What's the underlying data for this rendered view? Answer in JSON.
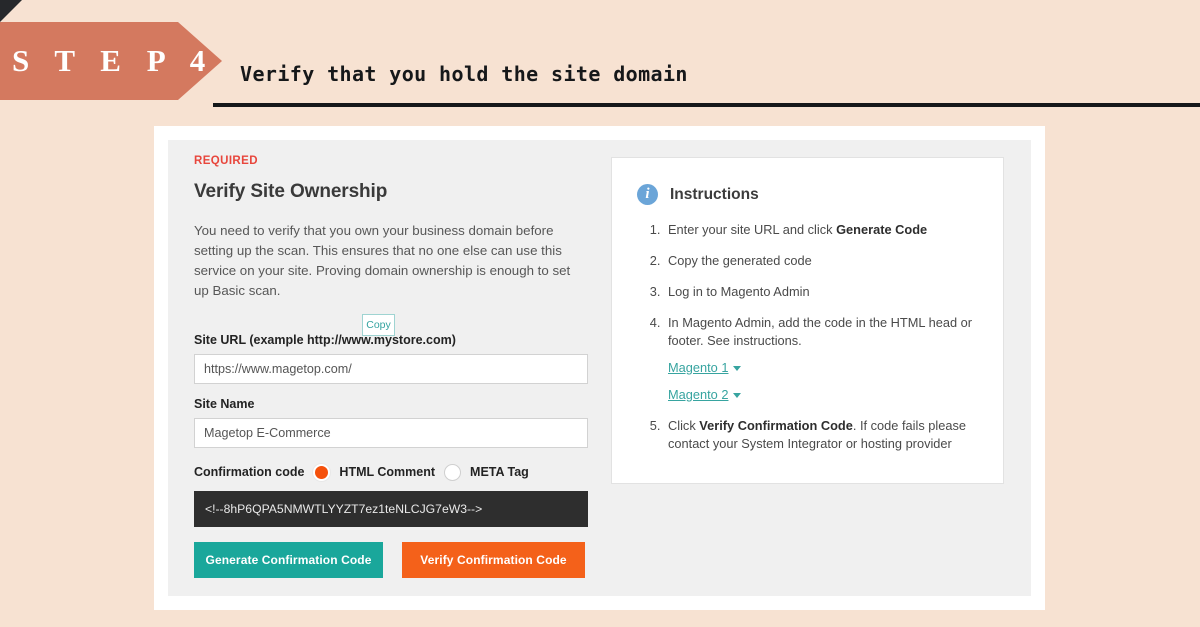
{
  "header": {
    "step_label": "S T E P   4",
    "title": "Verify that you hold the site domain"
  },
  "form": {
    "required_tag": "REQUIRED",
    "heading": "Verify Site Ownership",
    "description": "You need to verify that you own your business domain before setting up the scan. This ensures that no one else can use this service on your site. Proving domain ownership is enough to set up Basic scan.",
    "site_url_label": "Site URL (example http://www.mystore.com)",
    "site_url_value": "https://www.magetop.com/",
    "site_name_label": "Site Name",
    "site_name_value": "Magetop E-Commerce",
    "confirmation_code_label": "Confirmation code",
    "option_html_comment": "HTML Comment",
    "option_meta_tag": "META Tag",
    "copy_label": "Copy",
    "code_value": "<!--8hP6QPA5NMWTLYYZT7ez1teNLCJG7eW3-->",
    "generate_button": "Generate Confirmation Code",
    "verify_button": "Verify Confirmation Code"
  },
  "instructions": {
    "title": "Instructions",
    "steps": [
      "Enter your site URL and click ",
      "Copy the generated code",
      "Log in to Magento Admin",
      "In Magento Admin, add the code in the HTML head or footer. See instructions.",
      "Click "
    ],
    "step1_bold": "Generate Code",
    "step5_bold": "Verify Confirmation Code",
    "step5_rest": ". If code fails please contact your System Integrator or hosting provider",
    "link_magento1": "Magento 1",
    "link_magento2": "Magento 2"
  },
  "colors": {
    "page_background": "#f7e2d2",
    "banner": "#d4795f",
    "required": "#e8463c",
    "generate_button": "#1aa79b",
    "verify_button": "#f4611a",
    "radio_selected": "#f5510c",
    "link": "#37a4a0",
    "info_icon": "#6ba5d8",
    "code_background": "#2e2e2e"
  }
}
